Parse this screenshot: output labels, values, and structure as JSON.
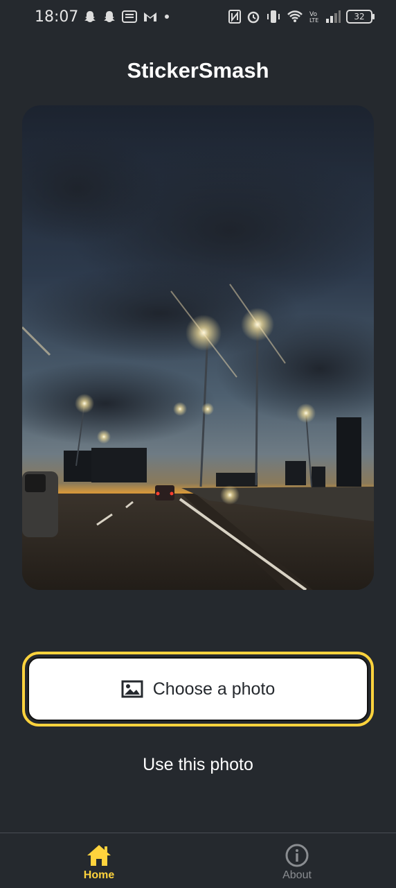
{
  "status_bar": {
    "time": "18:07",
    "battery": "32",
    "left_icons": [
      "snapchat-icon",
      "snapchat-icon",
      "news-icon",
      "gmail-icon",
      "dot-icon"
    ],
    "right_icons": [
      "nfc-icon",
      "alarm-icon",
      "vibrate-icon",
      "wifi-icon",
      "volte-icon",
      "signal-icon"
    ]
  },
  "header": {
    "title": "StickerSmash"
  },
  "image": {
    "description_icon": "photo-sky-road"
  },
  "actions": {
    "choose_label": "Choose a photo",
    "use_label": "Use this photo"
  },
  "tabs": [
    {
      "label": "Home",
      "icon": "home-icon",
      "active": true
    },
    {
      "label": "About",
      "icon": "info-icon",
      "active": false
    }
  ],
  "colors": {
    "background": "#25292e",
    "accent": "#ffd33d",
    "inactive": "#8a8d91"
  }
}
